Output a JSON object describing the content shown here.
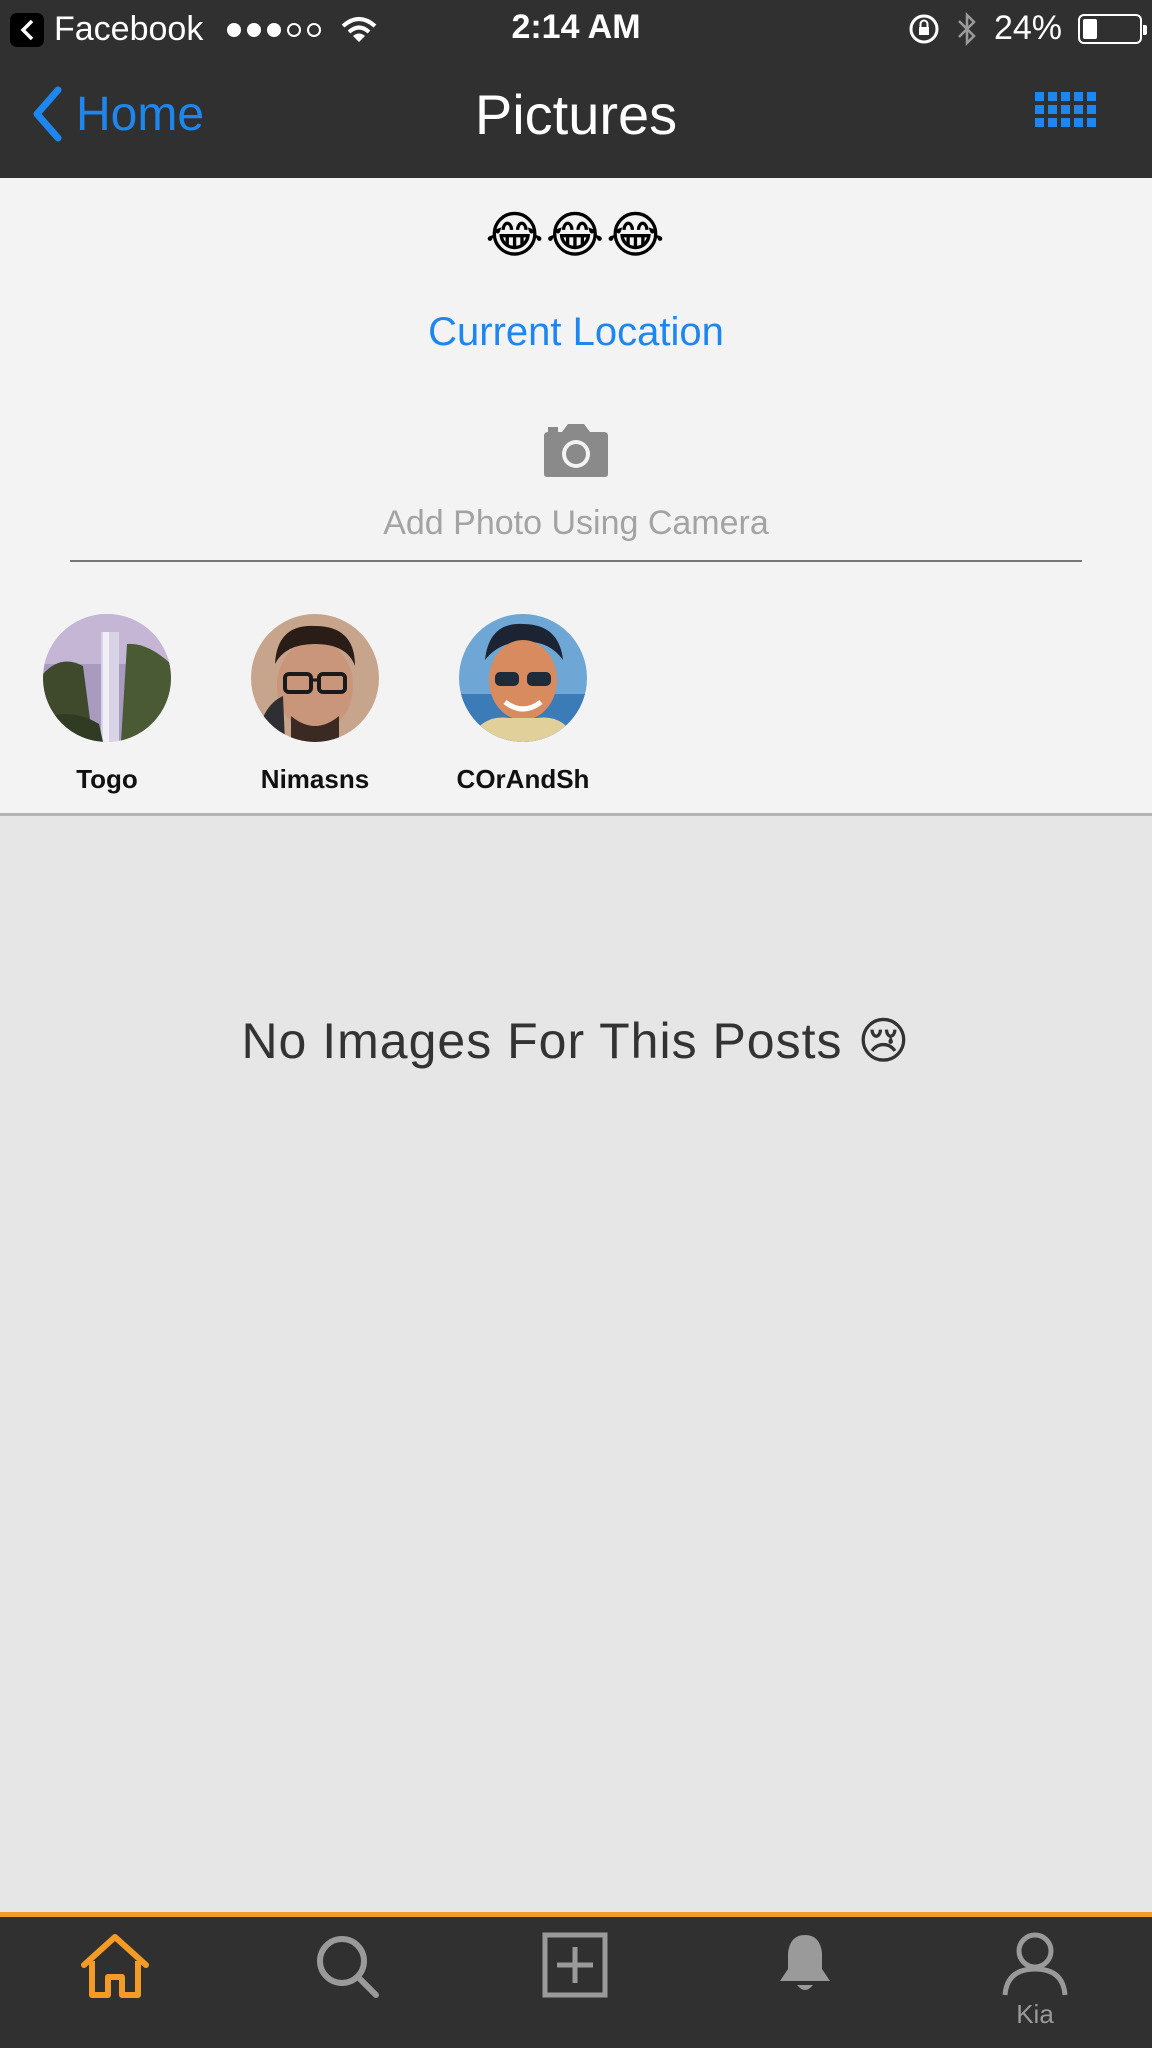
{
  "status_bar": {
    "back_app": "Facebook",
    "time": "2:14 AM",
    "battery": "24%",
    "signal_bars_filled": 3,
    "signal_bars_total": 5,
    "battery_level": 0.24
  },
  "nav": {
    "back_label": "Home",
    "title": "Pictures"
  },
  "header": {
    "emojis": "😂😂😂",
    "location_link": "Current Location",
    "camera_label": "Add Photo Using Camera"
  },
  "friends": [
    {
      "name": "Togo"
    },
    {
      "name": "Nimasns"
    },
    {
      "name": "COrAndSh"
    }
  ],
  "content": {
    "empty_message": "No Images For This Posts 😢"
  },
  "tab_bar": {
    "tabs": [
      {
        "icon": "home-icon",
        "active": true
      },
      {
        "icon": "search-icon",
        "active": false
      },
      {
        "icon": "add-icon",
        "active": false
      },
      {
        "icon": "bell-icon",
        "active": false
      },
      {
        "icon": "profile-icon",
        "label": "Kia",
        "active": false
      }
    ],
    "active_color": "#f49b25",
    "inactive_color": "#9a9a9a"
  },
  "colors": {
    "accent": "#1e87ef",
    "bar_background": "#303030"
  }
}
